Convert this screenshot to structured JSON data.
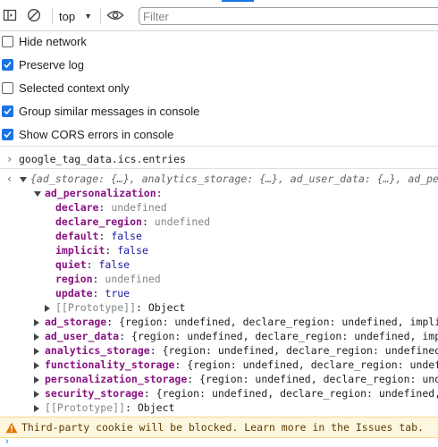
{
  "toolbar": {
    "context": "top",
    "filter_placeholder": "Filter"
  },
  "settings": [
    {
      "label": "Hide network",
      "checked": false
    },
    {
      "label": "Preserve log",
      "checked": true
    },
    {
      "label": "Selected context only",
      "checked": false
    },
    {
      "label": "Group similar messages in console",
      "checked": true
    },
    {
      "label": "Show CORS errors in console",
      "checked": true
    }
  ],
  "console": {
    "input_command": "google_tag_data.ics.entries",
    "result_summary": "{ad_storage: {…}, analytics_storage: {…}, ad_user_data: {…}, ad_perso",
    "expanded_key": "ad_personalization",
    "expanded_props": [
      {
        "key": "declare",
        "value": "undefined",
        "type": "undefined"
      },
      {
        "key": "declare_region",
        "value": "undefined",
        "type": "undefined"
      },
      {
        "key": "default",
        "value": "false",
        "type": "boolean"
      },
      {
        "key": "implicit",
        "value": "false",
        "type": "boolean"
      },
      {
        "key": "quiet",
        "value": "false",
        "type": "boolean"
      },
      {
        "key": "region",
        "value": "undefined",
        "type": "undefined"
      },
      {
        "key": "update",
        "value": "true",
        "type": "boolean"
      }
    ],
    "prototype_label": "[[Prototype]]",
    "prototype_value": "Object",
    "collapsed_entries": [
      {
        "key": "ad_storage",
        "preview": "{region: undefined, declare_region: undefined, implicit"
      },
      {
        "key": "ad_user_data",
        "preview": "{region: undefined, declare_region: undefined, implic"
      },
      {
        "key": "analytics_storage",
        "preview": "{region: undefined, declare_region: undefined, i"
      },
      {
        "key": "functionality_storage",
        "preview": "{region: undefined, declare_region: undefine"
      },
      {
        "key": "personalization_storage",
        "preview": "{region: undefined, declare_region: undefi"
      },
      {
        "key": "security_storage",
        "preview": "{region: undefined, declare_region: undefined, im"
      }
    ]
  },
  "warning": {
    "text": "Third-party cookie will be blocked. Learn more in the Issues tab."
  },
  "colors": {
    "accent": "#1a73e8",
    "warning_bg": "#fef7e0",
    "key_purple": "#881280",
    "boolean_blue": "#1a1aa6"
  }
}
